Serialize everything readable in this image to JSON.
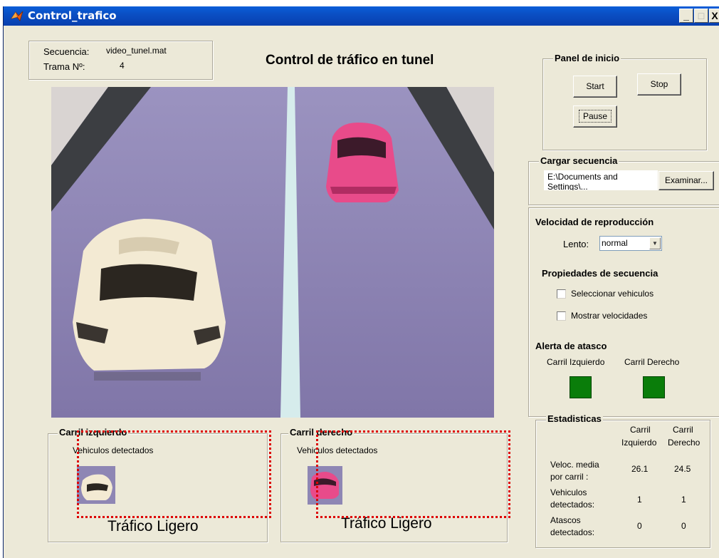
{
  "window": {
    "title": "Control_trafico",
    "controls": {
      "minimize": "_",
      "close": "X"
    }
  },
  "info": {
    "sequence_label": "Secuencia:",
    "sequence_value": "video_tunel.mat",
    "frame_label": "Trama Nº:",
    "frame_value": "4"
  },
  "main_title": "Control de tráfico en tunel",
  "start_panel": {
    "title": "Panel de inicio",
    "start": "Start",
    "stop": "Stop",
    "pause": "Pause"
  },
  "load_panel": {
    "title": "Cargar secuencia",
    "path": "E:\\Documents and Settings\\...",
    "browse": "Examinar..."
  },
  "speed": {
    "title": "Velocidad de reproducción",
    "label": "Lento:",
    "selected": "normal"
  },
  "properties": {
    "title": "Propiedades de secuencia",
    "select_vehicles": "Seleccionar vehiculos",
    "show_speeds": "Mostrar velocidades"
  },
  "alert": {
    "title": "Alerta de atasco",
    "left": "Carril Izquierdo",
    "right": "Carril Derecho",
    "color": "#0a7d0a"
  },
  "stats": {
    "title": "Estadisticas",
    "col_left": [
      "Carril",
      "Izquierdo"
    ],
    "col_right": [
      "Carril",
      "Derecho"
    ],
    "rows": [
      {
        "label": [
          "Veloc. media",
          "por carril :"
        ],
        "left": "26.1",
        "right": "24.5"
      },
      {
        "label": [
          "Vehiculos",
          "detectados:"
        ],
        "left": "1",
        "right": "1"
      },
      {
        "label": [
          "Atascos",
          "detectados:"
        ],
        "left": "0",
        "right": "0"
      }
    ]
  },
  "lane_left": {
    "title": "Carril izquierdo",
    "detected_label": "Vehiculos detectados",
    "traffic": "Tráfico Ligero"
  },
  "lane_right": {
    "title": "Carril derecho",
    "detected_label": "Vehiculos detectados",
    "traffic": "Tráfico Ligero"
  }
}
